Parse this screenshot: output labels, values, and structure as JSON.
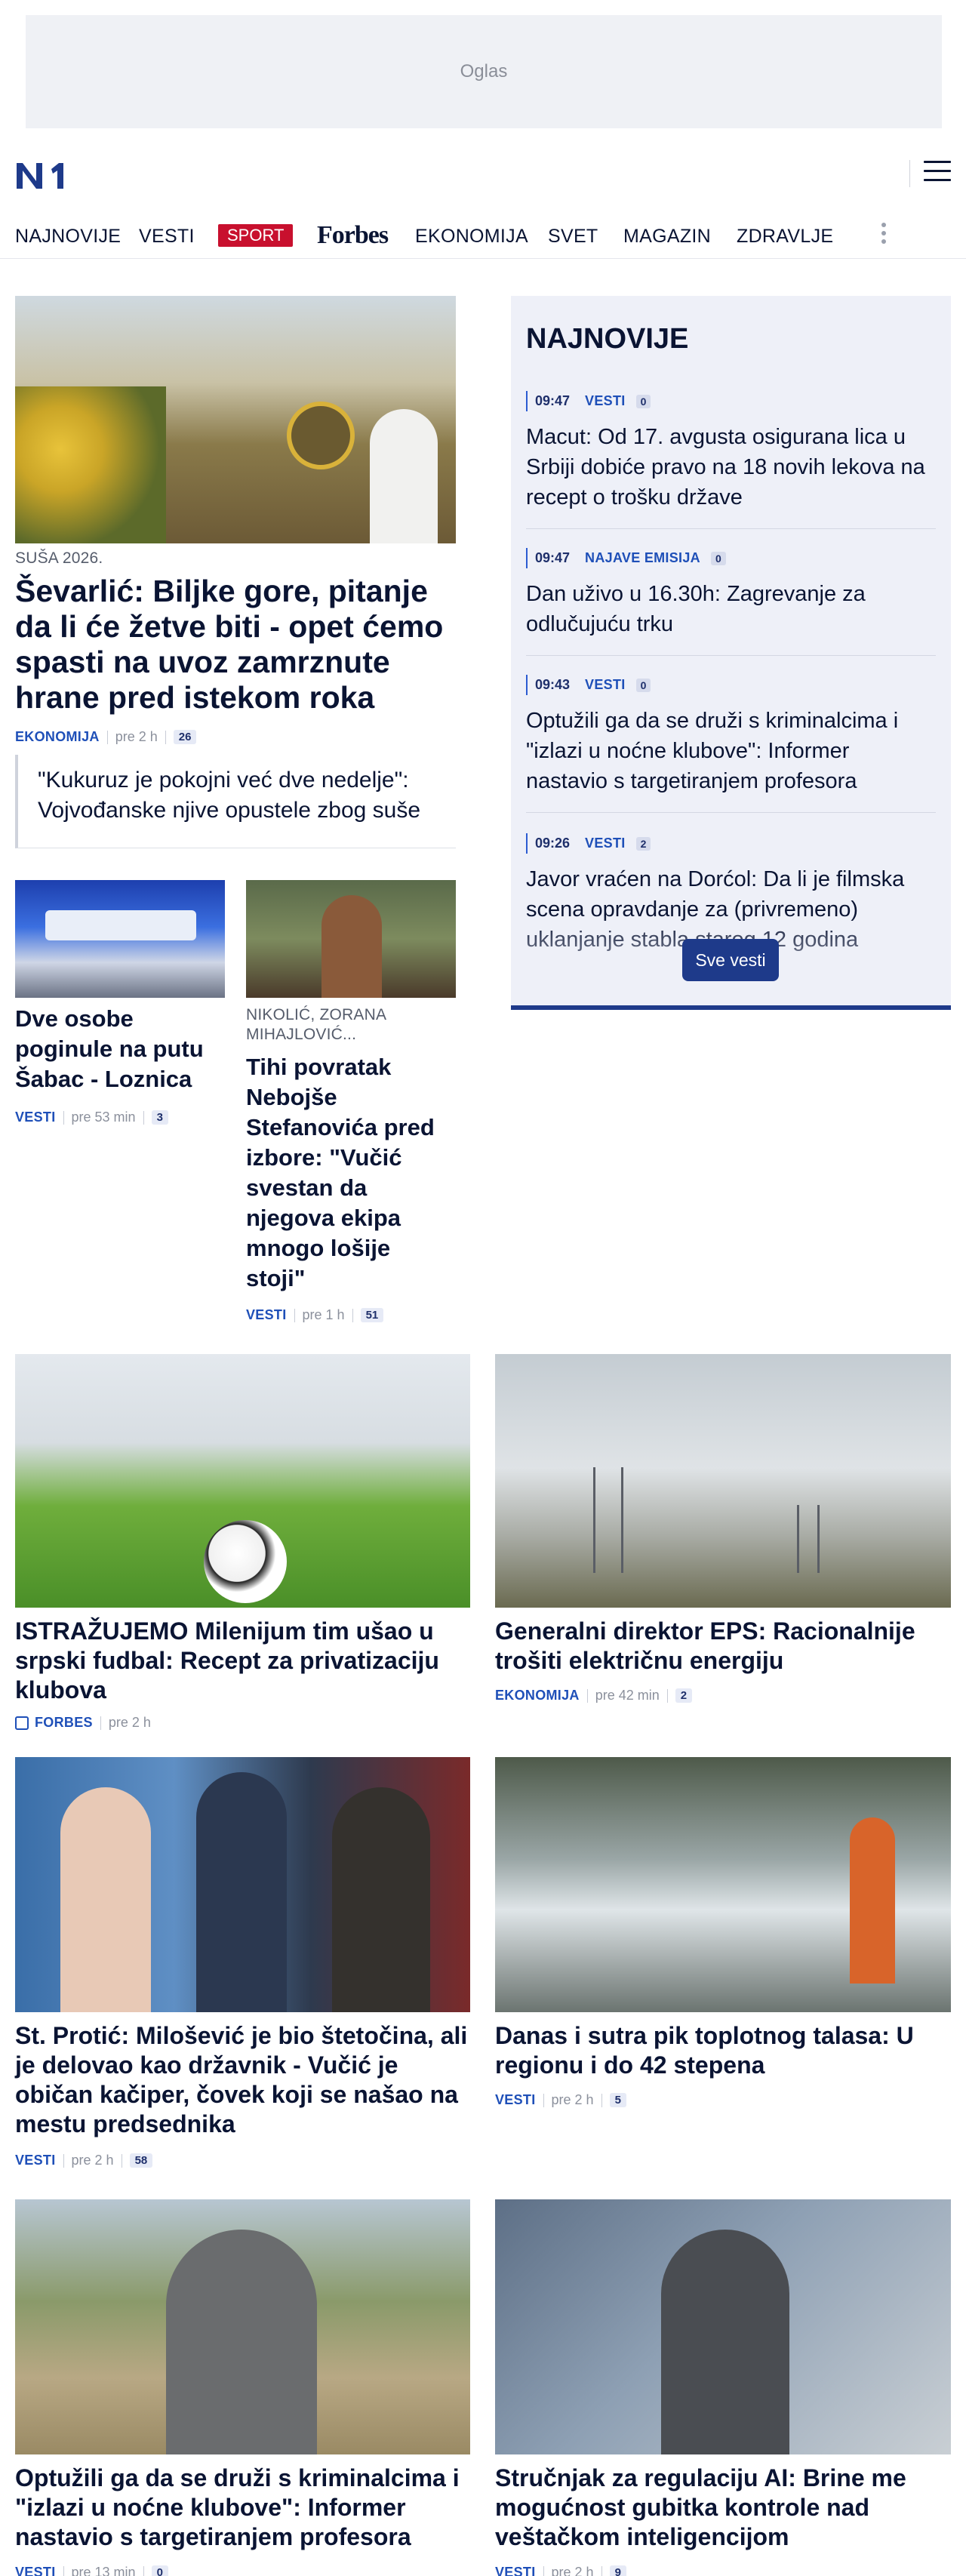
{
  "ad": {
    "label": "Oglas"
  },
  "header": {
    "logo": "N1"
  },
  "nav": {
    "items": [
      "NAJNOVIJE",
      "VESTI",
      "SPORT",
      "Forbes",
      "EKONOMIJA",
      "SVET",
      "MAGAZIN",
      "ZDRAVLJE"
    ]
  },
  "lead": {
    "kicker": "SUŠA 2026.",
    "title": "Ševarlić: Biljke gore, pitanje da li će žetve biti - opet ćemo spasti na uvoz zamrznute hrane pred istekom roka",
    "category": "EKONOMIJA",
    "time": "pre 2 h",
    "comments": "26",
    "related": "\"Kukuruz je pokojni već dve nedelje\": Vojvođanske njive opustele zbog suše"
  },
  "small1": {
    "title": "Dve osobe poginule na putu Šabac - Loznica",
    "category": "VESTI",
    "time": "pre 53 min",
    "comments": "3"
  },
  "small2": {
    "kicker": "NIKOLIĆ, ZORANA MIHAJLOVIĆ...",
    "title": "Tihi povratak Nebojše Stefanovića pred izbore: \"Vučić svestan da njegova ekipa mnogo lošije stoji\"",
    "category": "VESTI",
    "time": "pre 1 h",
    "comments": "51"
  },
  "sidebar": {
    "title": "NAJNOVIJE",
    "items": [
      {
        "time": "09:47",
        "category": "VESTI",
        "comments": "0",
        "text": "Macut: Od 17. avgusta osigurana lica u Srbiji dobiće pravo na 18 novih lekova na recept o trošku države"
      },
      {
        "time": "09:47",
        "category": "NAJAVE EMISIJA",
        "comments": "0",
        "text": "Dan uživo u 16.30h: Zagrevanje za odlučujuću trku"
      },
      {
        "time": "09:43",
        "category": "VESTI",
        "comments": "0",
        "text": "Optužili ga da se druži s kriminalcima i \"izlazi u noćne klubove\": Informer nastavio s targetiranjem profesora"
      },
      {
        "time": "09:26",
        "category": "VESTI",
        "comments": "2",
        "text": "Javor vraćen na Dorćol: Da li je filmska scena opravdanje za (privremeno) uklanjanje stabla starog 12 godina"
      }
    ],
    "button": "Sve vesti"
  },
  "cards": [
    {
      "title": "ISTRAŽUJEMO Milenijum tim ušao u srpski fudbal: Recept za privatizaciju klubova",
      "category": "FORBES",
      "time": "pre 2 h",
      "comments": ""
    },
    {
      "title": "Generalni direktor EPS: Racionalnije trošiti električnu energiju",
      "category": "EKONOMIJA",
      "time": "pre 42 min",
      "comments": "2"
    },
    {
      "title": "St. Protić: Milošević je bio štetočina, ali je delovao kao državnik - Vučić je običan kačiper, čovek koji se našao na mestu predsednika",
      "category": "VESTI",
      "time": "pre 2 h",
      "comments": "58"
    },
    {
      "title": "Danas i sutra pik toplotnog talasa: U regionu i do 42 stepena",
      "category": "VESTI",
      "time": "pre 2 h",
      "comments": "5"
    },
    {
      "title": "Optužili ga da se druži s kriminalcima i \"izlazi u noćne klubove\": Informer nastavio s targetiranjem profesora",
      "category": "VESTI",
      "time": "pre 13 min",
      "comments": "0"
    },
    {
      "title": "Stručnjak za regulaciju AI: Brine me mogućnost gubitka kontrole nad veštačkom inteligencijom",
      "category": "VESTI",
      "time": "pre 2 h",
      "comments": "9"
    }
  ],
  "colors": {
    "accent": "#1e3a8a",
    "sport": "#c8102e",
    "category": "#1e4fb8"
  }
}
